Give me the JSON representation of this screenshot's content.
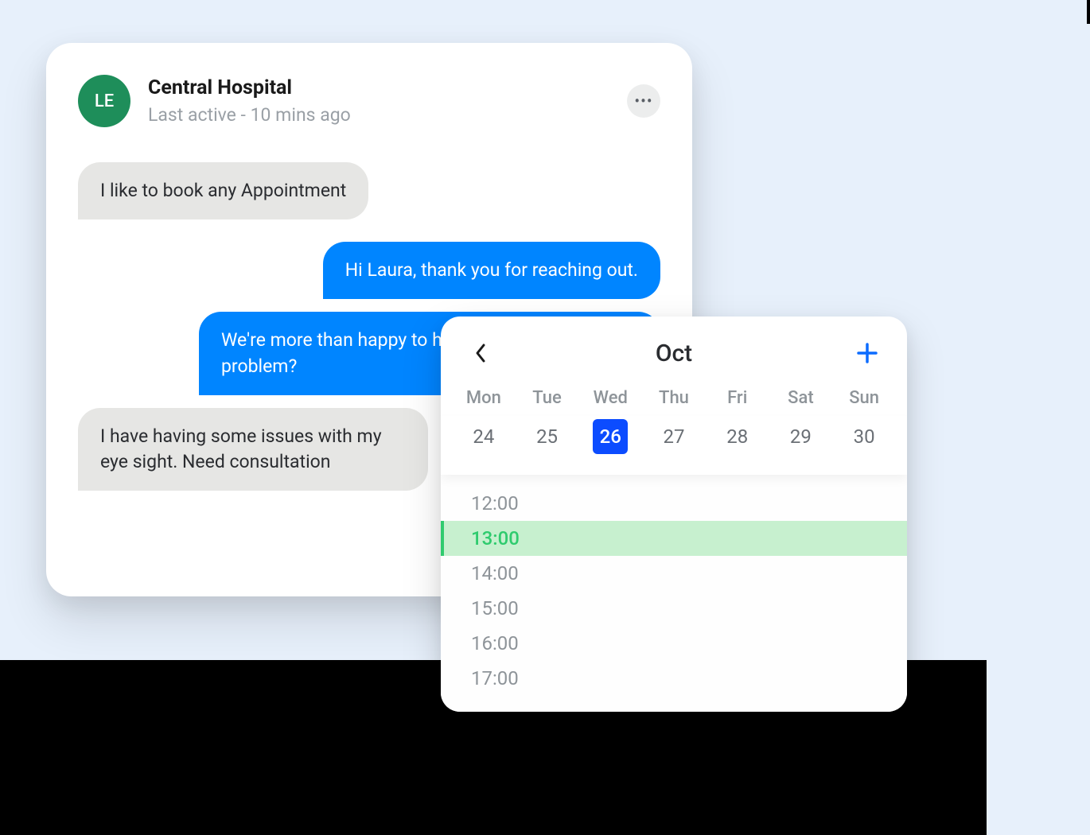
{
  "chat": {
    "avatar_initials": "LE",
    "contact_name": "Central Hospital",
    "last_active": "Last active - 10 mins ago",
    "messages": [
      {
        "text": "I like to book any Appointment",
        "direction": "incoming"
      },
      {
        "text": "Hi Laura, thank you for reaching out.",
        "direction": "outgoing"
      },
      {
        "text": "We're more than happy to help. What's the problem?",
        "direction": "outgoing"
      },
      {
        "text": "I have having some issues with my eye sight. Need consultation",
        "direction": "incoming"
      }
    ]
  },
  "calendar": {
    "month": "Oct",
    "day_names": [
      "Mon",
      "Tue",
      "Wed",
      "Thu",
      "Fri",
      "Sat",
      "Sun"
    ],
    "dates": [
      "24",
      "25",
      "26",
      "27",
      "28",
      "29",
      "30"
    ],
    "selected_date_index": 2,
    "time_slots": [
      "12:00",
      "13:00",
      "14:00",
      "15:00",
      "16:00",
      "17:00"
    ],
    "selected_time_index": 1
  }
}
